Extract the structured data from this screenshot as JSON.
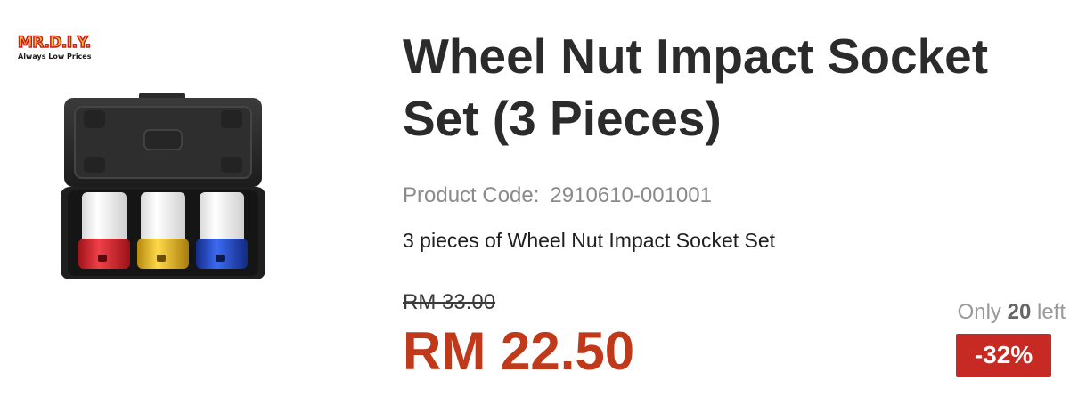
{
  "brand": {
    "logo_text": "MR.D.I.Y.",
    "tagline": "Always Low Prices",
    "colors": {
      "logo_fill": "#f2c230",
      "logo_outline": "#c8201e"
    }
  },
  "product": {
    "title": "Wheel Nut Impact Socket Set (3 Pieces)",
    "code_label": "Product Code:",
    "code_value": "2910610-001001",
    "description": "3 pieces of Wheel Nut Impact Socket Set",
    "image_icon": "socket-set-case-image",
    "socket_colors": [
      "#d8262b",
      "#e7b91c",
      "#2144b8"
    ]
  },
  "pricing": {
    "original_price": "RM 33.00",
    "price": "RM 22.50",
    "discount": "-32%",
    "price_color": "#c0391b",
    "badge_color": "#c62a22"
  },
  "stock": {
    "prefix": "Only",
    "count": "20",
    "suffix": "left"
  }
}
